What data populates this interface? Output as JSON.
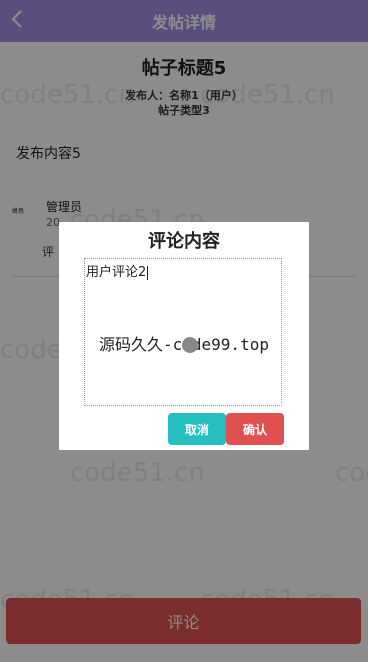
{
  "header": {
    "title": "发帖详情",
    "back_icon": "chevron-left-icon"
  },
  "post": {
    "title": "帖子标题5",
    "publisher": "发布人：名称1（用户）",
    "type": "帖子类型3",
    "content": "发布内容5"
  },
  "comment": {
    "avatar_text": "蜂鳥",
    "name": "管理员",
    "time": "20",
    "text": "评"
  },
  "bottom_button": {
    "label": "评论"
  },
  "dialog": {
    "title": "评论内容",
    "input_value": "用户评论2",
    "cancel_label": "取消",
    "confirm_label": "确认"
  },
  "watermarks": {
    "site_a": "code51.cn",
    "center": "源码久久-code99.top"
  },
  "colors": {
    "header": "#a58ee6",
    "cancel": "#26bfbf",
    "confirm": "#e15050",
    "bottom_button": "#e15050"
  }
}
